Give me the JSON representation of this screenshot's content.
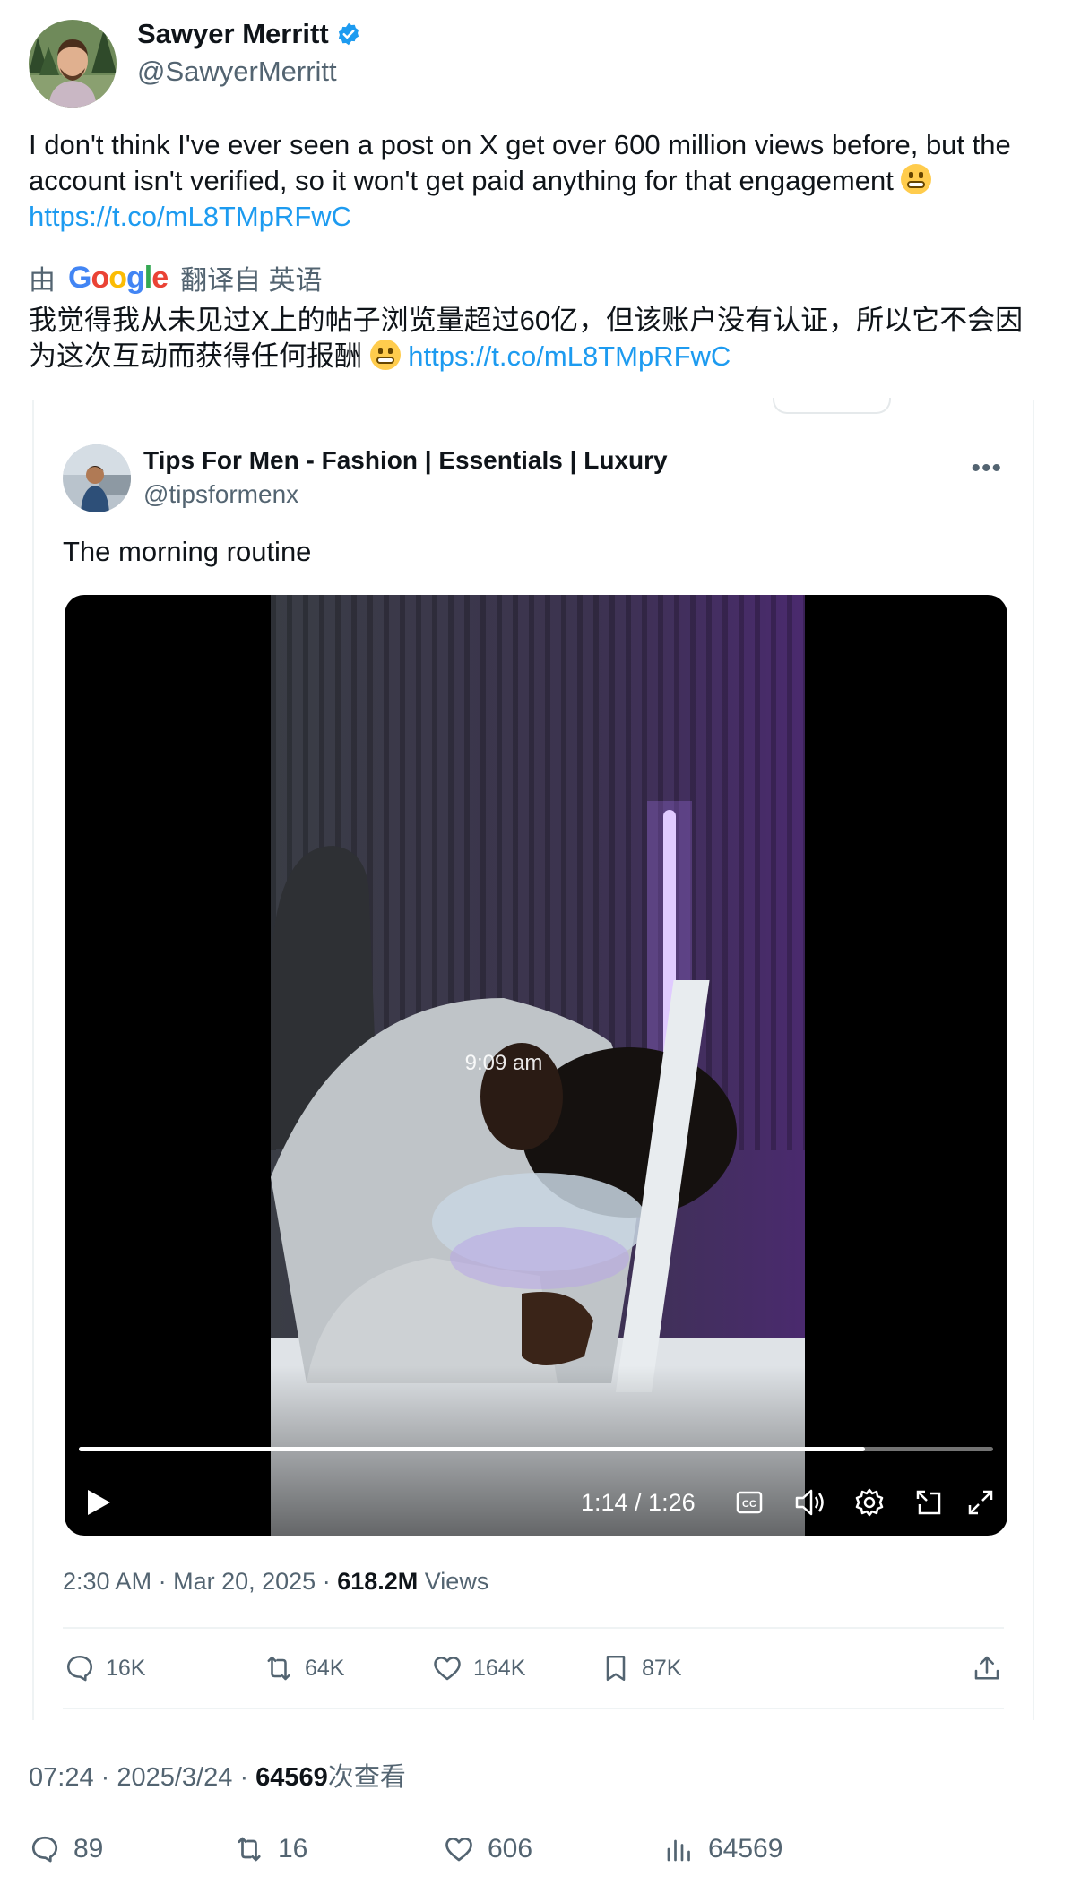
{
  "author": {
    "name": "Sawyer Merritt",
    "handle": "@SawyerMerritt",
    "verified": true,
    "verified_color": "#1d9bf0"
  },
  "tweet": {
    "text": "I don't think I've ever seen a post on X get over 600 million views before, but the account isn't verified, so it won't get paid anything for that engagement",
    "emoji": "grimacing-face",
    "link": "https://t.co/mL8TMpRFwC"
  },
  "translation": {
    "prefix": "由",
    "provider": "Google",
    "suffix": "翻译自 英语",
    "text": "我觉得我从未见过X上的帖子浏览量超过60亿，但该账户没有认证，所以它不会因为这次互动而获得任何报酬",
    "link": "https://t.co/mL8TMpRFwC"
  },
  "quoted": {
    "name": "Tips For Men - Fashion | Essentials | Luxury",
    "handle": "@tipsformenx",
    "more_label": "•••",
    "text": "The morning routine",
    "video": {
      "overlay_text": "9:09 am",
      "time": "1:14 / 1:26",
      "progress": 0.86
    },
    "meta": {
      "time": "2:30 AM",
      "date": "Mar 20, 2025",
      "views_count": "618.2M",
      "views_label": "Views"
    },
    "stats": {
      "replies": "16K",
      "reposts": "64K",
      "likes": "164K",
      "bookmarks": "87K"
    }
  },
  "meta": {
    "time": "07:24",
    "date": "2025/3/24",
    "views_count": "64569",
    "views_label": "次查看"
  },
  "stats": {
    "replies": "89",
    "reposts": "16",
    "likes": "606",
    "views": "64569"
  },
  "colors": {
    "link": "#1d9bf0",
    "text": "#0f1419",
    "secondary": "#536471",
    "border": "#eff3f4"
  }
}
